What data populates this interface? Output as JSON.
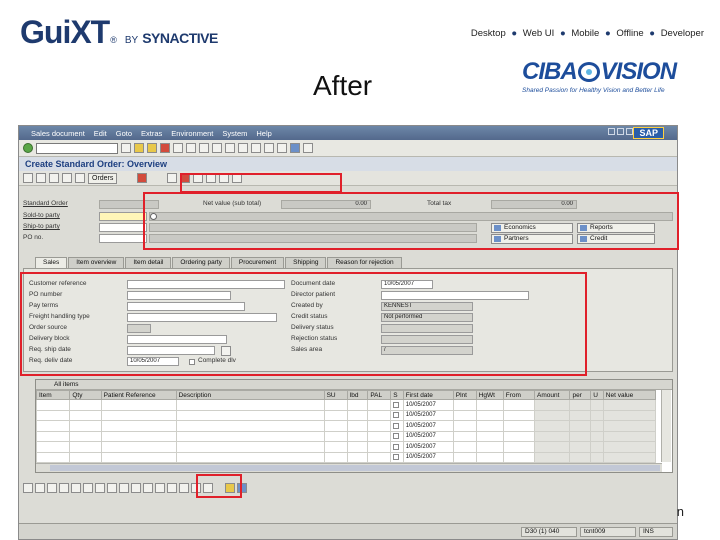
{
  "header": {
    "logo_main": "GuiXT",
    "logo_reg": "®",
    "logo_by": "BY",
    "logo_company": "SYNACTIVE",
    "nav": [
      "Desktop",
      "Web UI",
      "Mobile",
      "Offline",
      "Developer"
    ],
    "nav_sep": "●",
    "slide_title": "After",
    "partner_logo_left": "CIBA",
    "partner_logo_right": "VISION",
    "partner_tagline": "Shared Passion for Healthy Vision and Better Life",
    "page_number": "n"
  },
  "sap": {
    "menu": [
      "Sales document",
      "Edit",
      "Goto",
      "Extras",
      "Environment",
      "System",
      "Help"
    ],
    "brand": "SAP",
    "screen_title": "Create Standard Order: Overview",
    "orders_button": "Orders",
    "header_fields": {
      "standard_order_label": "Standard Order",
      "sold_to_label": "Sold-to party",
      "ship_to_label": "Ship-to party",
      "po_label": "PO no.",
      "net_value_label": "Net value (sub total)",
      "net_value": "0.00",
      "total_tax_label": "Total tax",
      "total_tax": "0.00",
      "btn_economics": "Economics",
      "btn_partners": "Partners",
      "btn_reports": "Reports",
      "btn_credit": "Credit"
    },
    "tabs": [
      "Sales",
      "Item overview",
      "Item detail",
      "Ordering party",
      "Procurement",
      "Shipping",
      "Reason for rejection"
    ],
    "sales_tab": {
      "customer_reference_label": "Customer reference",
      "po_number_label": "PO number",
      "pay_terms_label": "Pay terms",
      "freight_label": "Freight handling type",
      "order_source_label": "Order source",
      "delivery_block_label": "Delivery block",
      "req_ship_label": "Req. ship date",
      "req_deliv_label": "Req. deliv date",
      "req_deliv_date": "10/05/2007",
      "complete_dlv_label": "Complete dlv",
      "document_date_label": "Document date",
      "document_date": "10/05/2007",
      "dir_ctry_label": "Director patient",
      "created_by_label": "Created by",
      "created_by": "KENNEST",
      "credit_status_label": "Credit status",
      "credit_status": "Not performed",
      "delivery_status_label": "Delivery status",
      "rejection_status_label": "Rejection status",
      "sales_area_label": "Sales area",
      "sales_area": "/"
    },
    "grid": {
      "caption": "All items",
      "columns": [
        "Item",
        "Qty",
        "Patient Reference",
        "Description",
        "SU",
        "Ibd",
        "PAL",
        "S",
        "First date",
        "Plnt",
        "HgWt",
        "From",
        "Amount",
        "per",
        "U",
        "Net value"
      ],
      "first_dates": [
        "10/05/2007",
        "10/05/2007",
        "10/05/2007",
        "10/05/2007",
        "10/05/2007",
        "10/05/2007"
      ]
    },
    "status": {
      "system": "D30 (1) 040",
      "server": "tcnt009",
      "mode": "INS"
    }
  }
}
